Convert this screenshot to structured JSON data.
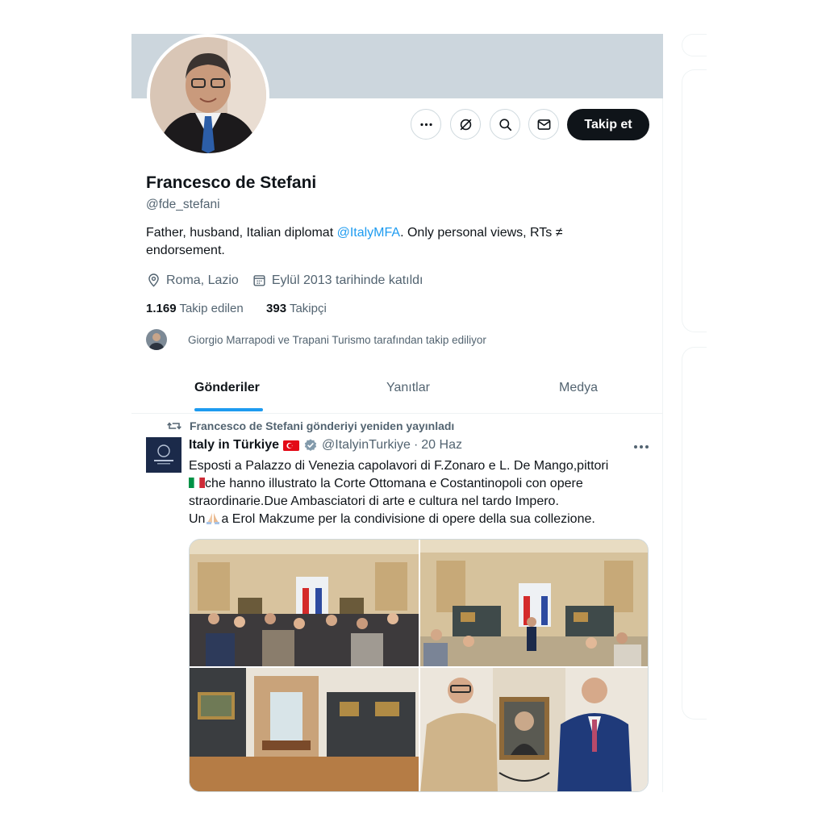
{
  "profile": {
    "name": "Francesco de Stefani",
    "handle": "@fde_stefani",
    "bio_prefix": "Father, husband, Italian diplomat ",
    "bio_mention": "@ItalyMFA",
    "bio_suffix": ". Only personal views, RTs ≠ endorsement.",
    "location": "Roma, Lazio",
    "joined": "Eylül 2013 tarihinde katıldı",
    "following_count": "1.169",
    "following_label": "Takip edilen",
    "followers_count": "393",
    "followers_label": "Takipçi",
    "followed_by_text": "Giorgio Marrapodi ve Trapani Turismo tarafından takip ediliyor",
    "follow_button": "Takip et"
  },
  "icons": {
    "more": "more-horizontal-icon",
    "grok": "grok-icon",
    "search": "search-icon",
    "message": "mail-icon",
    "location": "location-pin-icon",
    "calendar": "calendar-icon",
    "retweet": "retweet-icon",
    "verified": "verified-badge-icon"
  },
  "tabs": [
    {
      "label": "Gönderiler",
      "active": true
    },
    {
      "label": "Yanıtlar",
      "active": false
    },
    {
      "label": "Medya",
      "active": false
    }
  ],
  "tweet": {
    "retweet_label": "Francesco de Stefani gönderiyi yeniden yayınladı",
    "author": "Italy in Türkiye",
    "handle": "@ItalyinTurkiye",
    "separator": "·",
    "date": "20 Haz",
    "text_line1": "Esposti a Palazzo di Venezia capolavori di F.Zonaro e L. De Mango,pittori",
    "text_line2": "che hanno illustrato la Corte Ottomana e Costantinopoli con opere",
    "text_line3": "straordinarie.Due Ambasciatori di arte e cultura nel tardo Impero.",
    "text_line4_prefix": "Un",
    "text_line4_suffix": "a Erol Makzume per la condivisione di opere della sua collezione."
  },
  "colors": {
    "accent": "#1d9bf0",
    "banner": "#ccd6dd",
    "text_primary": "#0f1419",
    "text_secondary": "#536471"
  }
}
